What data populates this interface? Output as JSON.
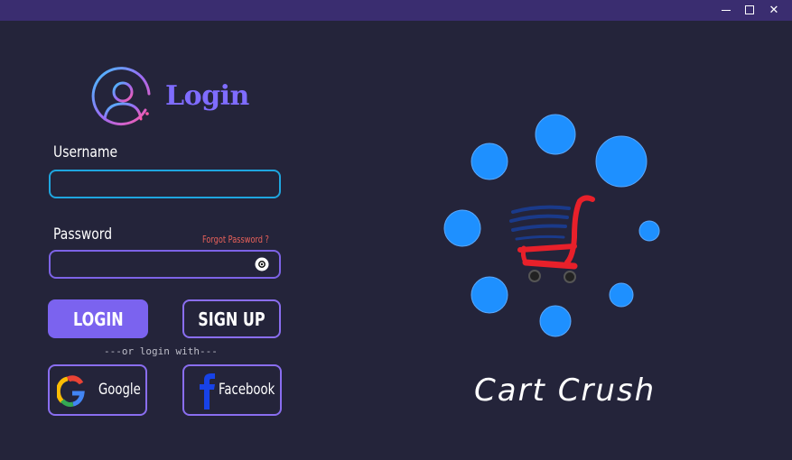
{
  "window": {
    "minimize_icon": "minimize-icon",
    "maximize_icon": "maximize-icon",
    "close_glyph": "✕"
  },
  "login_panel": {
    "title": "Login",
    "username_label": "Username",
    "username_value": "",
    "password_label": "Password",
    "password_value": "",
    "forgot_password": "Forgot Password ?",
    "login_button": "LOGIN",
    "signup_button": "SIGN UP",
    "divider_text": "---or login with---",
    "google_button": "Google",
    "facebook_button": "Facebook"
  },
  "brand": {
    "name": "Cart Crush"
  },
  "colors": {
    "background": "#24243a",
    "titlebar": "#3a2d70",
    "accent_purple": "#7b63ef",
    "input_blue": "#1fa6df",
    "forgot_red": "#e8615a",
    "dot_blue": "#1e90ff",
    "cart_red": "#e8202a",
    "cart_navy": "#1a3a8a"
  }
}
